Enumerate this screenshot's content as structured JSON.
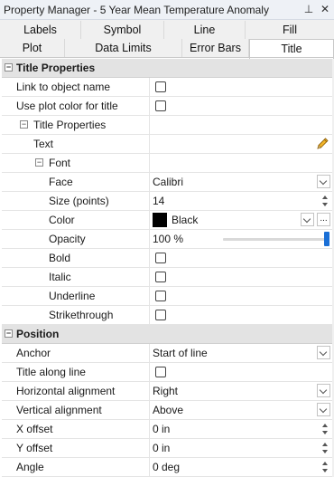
{
  "window": {
    "title": "Property Manager - 5 Year Mean Temperature Anomaly",
    "pin_glyph": "⊥",
    "close_glyph": "✕"
  },
  "tabs": {
    "row1": [
      "Labels",
      "Symbol",
      "Line",
      "Fill"
    ],
    "row2": [
      "Plot",
      "Data Limits",
      "Error Bars",
      "Title"
    ],
    "active": "Title"
  },
  "sections": {
    "title_properties": {
      "label": "Title Properties",
      "link_to_object_name": {
        "label": "Link to object name",
        "checked": false
      },
      "use_plot_color": {
        "label": "Use plot color for title",
        "checked": false
      },
      "sub": {
        "label": "Title Properties",
        "text": {
          "label": "Text",
          "value": ""
        },
        "font": {
          "label": "Font",
          "face": {
            "label": "Face",
            "value": "Calibri"
          },
          "size": {
            "label": "Size (points)",
            "value": "14"
          },
          "color": {
            "label": "Color",
            "value": "Black",
            "swatch": "#000000"
          },
          "opacity": {
            "label": "Opacity",
            "value": "100 %",
            "level": 1.0
          },
          "bold": {
            "label": "Bold",
            "checked": false
          },
          "italic": {
            "label": "Italic",
            "checked": false
          },
          "underline": {
            "label": "Underline",
            "checked": false
          },
          "strikethrough": {
            "label": "Strikethrough",
            "checked": false
          }
        }
      }
    },
    "position": {
      "label": "Position",
      "anchor": {
        "label": "Anchor",
        "value": "Start of line"
      },
      "title_along_line": {
        "label": "Title along line",
        "checked": false
      },
      "h_align": {
        "label": "Horizontal alignment",
        "value": "Right"
      },
      "v_align": {
        "label": "Vertical alignment",
        "value": "Above"
      },
      "x_offset": {
        "label": "X offset",
        "value": "0 in"
      },
      "y_offset": {
        "label": "Y offset",
        "value": "0 in"
      },
      "angle": {
        "label": "Angle",
        "value": "0 deg"
      }
    }
  },
  "colors": {
    "accent": "#1a6fd6",
    "category_bg": "#e3e3e3",
    "grid_line": "#e4e4e4"
  }
}
